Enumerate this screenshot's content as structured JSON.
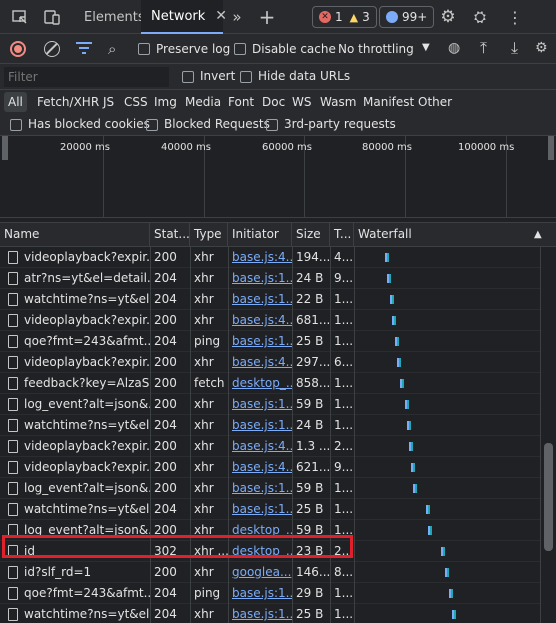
{
  "tabs": {
    "elements": "Elements",
    "network": "Network",
    "errors": "1",
    "warnings": "3",
    "messages": "99+"
  },
  "toolbar": {
    "preserve_log": "Preserve log",
    "disable_cache": "Disable cache",
    "throttling": "No throttling"
  },
  "filter": {
    "placeholder": "Filter",
    "invert": "Invert",
    "hide_data_urls": "Hide data URLs"
  },
  "types": [
    "All",
    "Fetch/XHR",
    "JS",
    "CSS",
    "Img",
    "Media",
    "Font",
    "Doc",
    "WS",
    "Wasm",
    "Manifest",
    "Other"
  ],
  "blocked": {
    "has_blocked_cookies": "Has blocked cookies",
    "blocked_requests": "Blocked Requests",
    "third_party": "3rd-party requests"
  },
  "overview": {
    "ticks": [
      "20000 ms",
      "40000 ms",
      "60000 ms",
      "80000 ms",
      "100000 ms"
    ]
  },
  "columns": {
    "name": "Name",
    "status": "Stat...",
    "type": "Type",
    "initiator": "Initiator",
    "size": "Size",
    "time": "T...",
    "waterfall": "Waterfall"
  },
  "rows": [
    {
      "name": "videoplayback?expir...",
      "status": "200",
      "type": "xhr",
      "initiator": "base.js:4...",
      "size": "194...",
      "time": "4..."
    },
    {
      "name": "atr?ns=yt&el=detail...",
      "status": "204",
      "type": "xhr",
      "initiator": "base.js:1...",
      "size": "24 B",
      "time": "9..."
    },
    {
      "name": "watchtime?ns=yt&el...",
      "status": "204",
      "type": "xhr",
      "initiator": "base.js:1...",
      "size": "22 B",
      "time": "1..."
    },
    {
      "name": "videoplayback?expir...",
      "status": "200",
      "type": "xhr",
      "initiator": "base.js:4...",
      "size": "681...",
      "time": "1..."
    },
    {
      "name": "qoe?fmt=243&afmt...",
      "status": "204",
      "type": "ping",
      "initiator": "base.js:1...",
      "size": "25 B",
      "time": "1..."
    },
    {
      "name": "videoplayback?expir...",
      "status": "200",
      "type": "xhr",
      "initiator": "base.js:4...",
      "size": "297...",
      "time": "6..."
    },
    {
      "name": "feedback?key=AlzaS...",
      "status": "200",
      "type": "fetch",
      "initiator": "desktop_...",
      "size": "858...",
      "time": "1..."
    },
    {
      "name": "log_event?alt=json&...",
      "status": "200",
      "type": "xhr",
      "initiator": "base.js:1...",
      "size": "59 B",
      "time": "1..."
    },
    {
      "name": "watchtime?ns=yt&el...",
      "status": "204",
      "type": "xhr",
      "initiator": "base.js:1...",
      "size": "24 B",
      "time": "1..."
    },
    {
      "name": "videoplayback?expir...",
      "status": "200",
      "type": "xhr",
      "initiator": "base.js:4...",
      "size": "1.3 ...",
      "time": "2..."
    },
    {
      "name": "videoplayback?expir...",
      "status": "200",
      "type": "xhr",
      "initiator": "base.js:4...",
      "size": "621...",
      "time": "9..."
    },
    {
      "name": "log_event?alt=json&...",
      "status": "200",
      "type": "xhr",
      "initiator": "base.js:1...",
      "size": "59 B",
      "time": "1..."
    },
    {
      "name": "watchtime?ns=yt&el...",
      "status": "204",
      "type": "xhr",
      "initiator": "base.js:1...",
      "size": "25 B",
      "time": "1..."
    },
    {
      "name": "log_event?alt=json&...",
      "status": "200",
      "type": "xhr",
      "initiator": "desktop_...",
      "size": "59 B",
      "time": "1..."
    },
    {
      "name": "id",
      "status": "302",
      "type": "xhr ...",
      "initiator": "desktop_...",
      "size": "23 B",
      "time": "2..."
    },
    {
      "name": "id?slf_rd=1",
      "status": "200",
      "type": "xhr",
      "initiator": "googlea...",
      "size": "146...",
      "time": "8..."
    },
    {
      "name": "qoe?fmt=243&afmt...",
      "status": "204",
      "type": "ping",
      "initiator": "base.js:1...",
      "size": "29 B",
      "time": "1..."
    },
    {
      "name": "watchtime?ns=yt&el...",
      "status": "204",
      "type": "xhr",
      "initiator": "base.js:1...",
      "size": "25 B",
      "time": "1..."
    }
  ]
}
